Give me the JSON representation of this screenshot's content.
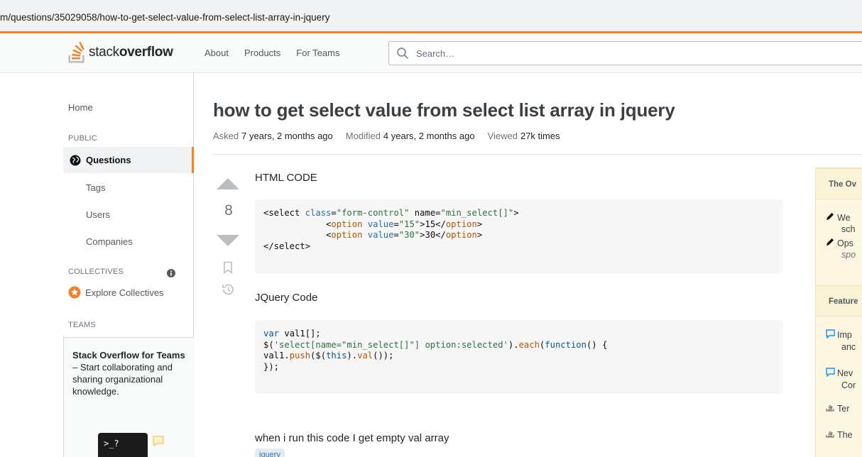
{
  "browser": {
    "url": "m/questions/35029058/how-to-get-select-value-from-select-list-array-in-jquery"
  },
  "header": {
    "logo_light": "stack",
    "logo_bold": "overflow",
    "nav": [
      "About",
      "Products",
      "For Teams"
    ],
    "search_placeholder": "Search…"
  },
  "sidebar": {
    "home": "Home",
    "public_heading": "PUBLIC",
    "questions": "Questions",
    "tags": "Tags",
    "users": "Users",
    "companies": "Companies",
    "collectives_heading": "COLLECTIVES",
    "explore_collectives": "Explore Collectives",
    "teams_heading": "TEAMS",
    "teams_title": "Stack Overflow for Teams",
    "teams_desc": " – Start collaborating and sharing organizational knowledge.",
    "terminal_prompt": ">_?"
  },
  "question": {
    "title": "how to get select value from select list array in jquery",
    "asked_label": "Asked",
    "asked_value": "7 years, 2 months ago",
    "modified_label": "Modified",
    "modified_value": "4 years, 2 months ago",
    "viewed_label": "Viewed",
    "viewed_value": "27k times",
    "score": "8",
    "html_heading": "HTML CODE",
    "jquery_heading": "JQuery Code",
    "closing_text": "when i run this code I get empty val array",
    "tag": "jquery"
  },
  "right_panel": {
    "heading1": "The Ov",
    "items1": [
      {
        "l1": "We",
        "l2": "sch"
      },
      {
        "l1": "Ops",
        "l2": "spo"
      }
    ],
    "heading2": "Feature",
    "items2": [
      {
        "l1": "Imp",
        "l2": "anc"
      },
      {
        "l1": "Nev",
        "l2": "Cor"
      },
      {
        "l1": "Ter",
        "l2": ""
      },
      {
        "l1": "The",
        "l2": ""
      }
    ]
  },
  "colors": {
    "accent": "#f48225",
    "link_blue": "#39739d"
  }
}
